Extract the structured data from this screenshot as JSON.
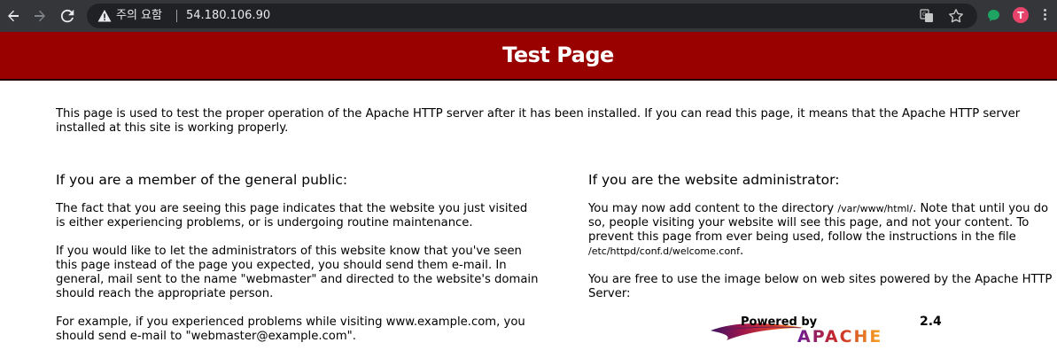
{
  "browser": {
    "security_label": "주의 요함",
    "url": "54.180.106.90",
    "profile_initial": "T",
    "colors": {
      "chrome_bg": "#35363a",
      "omnibox_bg": "#202124",
      "extension_green": "#1ea362",
      "profile_pink": "#e8436b"
    }
  },
  "page": {
    "title": "Test Page",
    "banner_color": "#990000",
    "intro": "This page is used to test the proper operation of the Apache HTTP server after it has been installed. If you can read this page, it means that the Apache HTTP server installed at this site is working properly.",
    "public": {
      "heading": "If you are a member of the general public:",
      "p1": "The fact that you are seeing this page indicates that the website you just visited is either experiencing problems, or is undergoing routine maintenance.",
      "p2": "If you would like to let the administrators of this website know that you've seen this page instead of the page you expected, you should send them e-mail. In general, mail sent to the name \"webmaster\" and directed to the website's domain should reach the appropriate person.",
      "p3": "For example, if you experienced problems while visiting www.example.com, you should send e-mail to \"webmaster@example.com\"."
    },
    "admin": {
      "heading": "If you are the website administrator:",
      "p1_before": "You may now add content to the directory ",
      "p1_path": "/var/www/html/",
      "p1_middle": ". Note that until you do so, people visiting your website will see this page, and not your content. To prevent this page from ever being used, follow the instructions in the file ",
      "p1_file": "/etc/httpd/conf.d/welcome.conf",
      "p1_after": ".",
      "p2": "You are free to use the image below on web sites powered by the Apache HTTP Server:"
    },
    "powered_badge": {
      "powered_by": "Powered by",
      "version": "2.4",
      "brand": "APACHE"
    }
  }
}
